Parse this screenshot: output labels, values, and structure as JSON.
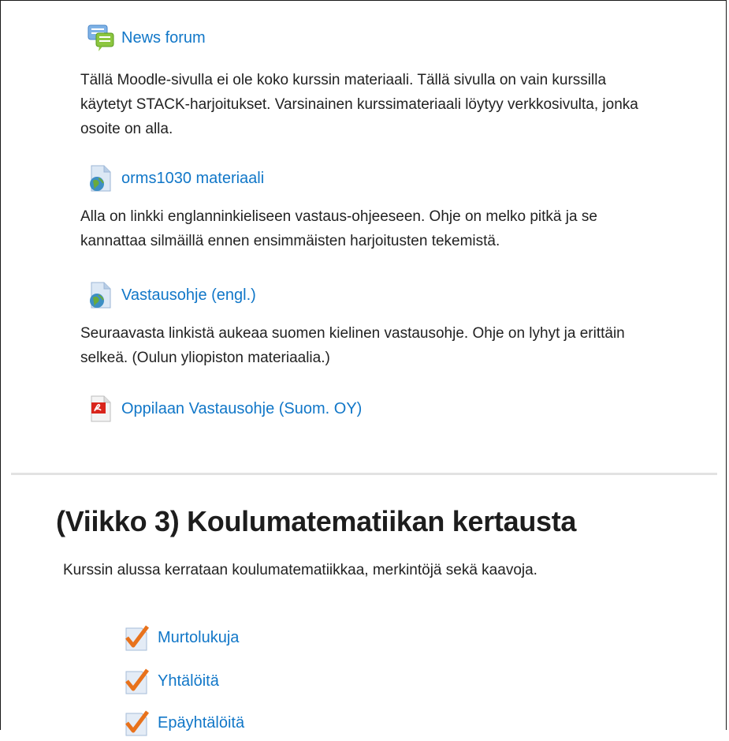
{
  "activities_top": [
    {
      "label": "News forum",
      "icon": "forum-icon"
    },
    {
      "label": "orms1030 materiaali",
      "icon": "url-globe-icon"
    },
    {
      "label": "Vastausohje (engl.)",
      "icon": "url-globe-icon"
    },
    {
      "label": "Oppilaan Vastausohje (Suom. OY)",
      "icon": "pdf-icon"
    }
  ],
  "labels": {
    "intro": "Tällä Moodle-sivulla ei ole koko kurssin materiaali. Tällä sivulla on vain kurssilla käytetyt STACK-harjoitukset. Varsinainen kurssimateriaali löytyy verkkosivulta, jonka osoite on alla.",
    "english_guide": "Alla on linkki englanninkieliseen vastaus-ohjeeseen. Ohje on melko pitkä ja se kannattaa silmäillä ennen ensimmäisten harjoitusten tekemistä.",
    "finnish_guide": "Seuraavasta linkistä aukeaa suomen kielinen vastausohje. Ohje on lyhyt ja erittäin selkeä. (Oulun yliopiston materiaalia.)"
  },
  "section": {
    "title": "(Viikko 3) Koulumatematiikan kertausta",
    "summary": "Kurssin alussa kerrataan koulumatematiikkaa, merkintöjä sekä kaavoja.",
    "quizzes": [
      {
        "label": "Murtolukuja"
      },
      {
        "label": "Yhtälöitä"
      },
      {
        "label": "Epäyhtälöitä"
      }
    ]
  },
  "colors": {
    "link": "#1177c8",
    "quiz_check": "#e8721c"
  }
}
